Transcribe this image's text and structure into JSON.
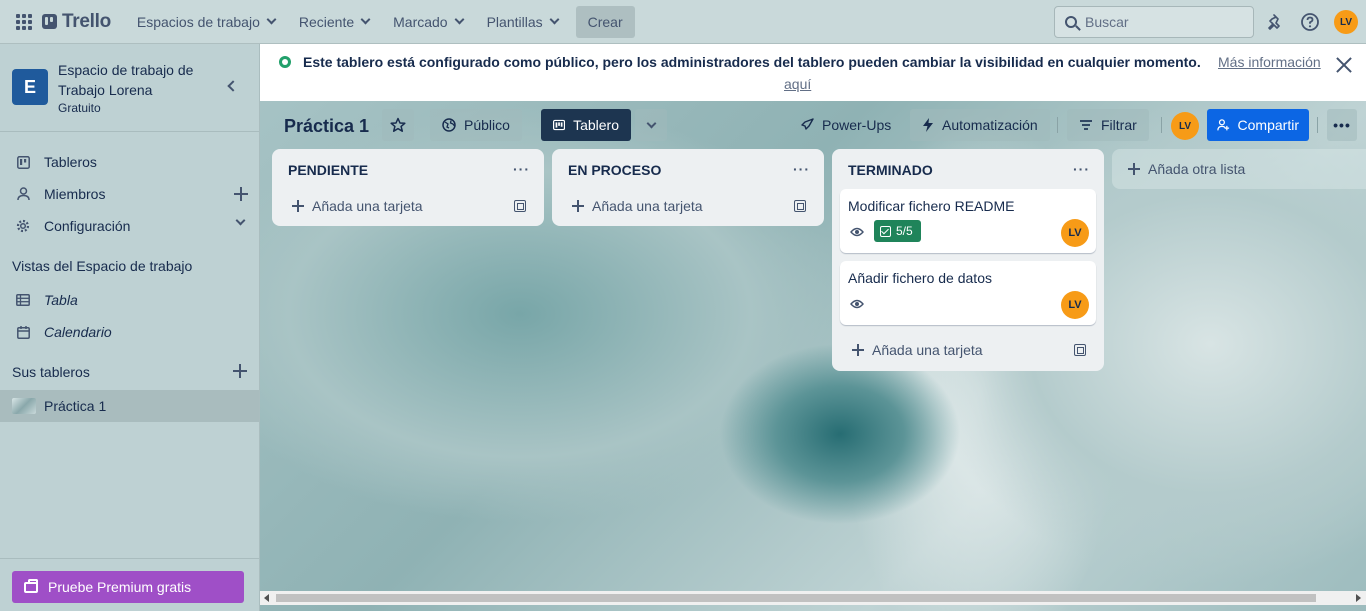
{
  "topnav": {
    "logo": "Trello",
    "menus": [
      "Espacios de trabajo",
      "Reciente",
      "Marcado",
      "Plantillas"
    ],
    "create_label": "Crear",
    "search_placeholder": "Buscar",
    "avatar_initials": "LV"
  },
  "sidebar": {
    "workspace_initial": "E",
    "workspace_name_line1": "Espacio de trabajo de",
    "workspace_name_line2": "Trabajo Lorena",
    "workspace_plan": "Gratuito",
    "items": [
      {
        "label": "Tableros",
        "icon": "board-icon"
      },
      {
        "label": "Miembros",
        "icon": "person-icon"
      },
      {
        "label": "Configuración",
        "icon": "gear-icon"
      }
    ],
    "views_title": "Vistas del Espacio de trabajo",
    "views": [
      {
        "label": "Tabla",
        "icon": "table-icon"
      },
      {
        "label": "Calendario",
        "icon": "calendar-icon"
      }
    ],
    "boards_title": "Sus tableros",
    "boards": [
      {
        "label": "Práctica 1"
      }
    ],
    "premium_label": "Pruebe Premium gratis"
  },
  "banner": {
    "text": "Este tablero está configurado como público, pero los administradores del tablero pueden cambiar la visibilidad en cualquier momento.",
    "link_part1": "Más información",
    "link_part2": "aquí"
  },
  "board": {
    "title": "Práctica 1",
    "visibility": "Público",
    "view": "Tablero",
    "powerups": "Power-Ups",
    "automation": "Automatización",
    "filter": "Filtrar",
    "member_initials": "LV",
    "share": "Compartir",
    "add_list": "Añada otra lista"
  },
  "lists": [
    {
      "title": "PENDIENTE",
      "add_card": "Añada una tarjeta",
      "cards": []
    },
    {
      "title": "EN PROCESO",
      "add_card": "Añada una tarjeta",
      "cards": []
    },
    {
      "title": "TERMINADO",
      "add_card": "Añada una tarjeta",
      "cards": [
        {
          "title": "Modificar fichero README",
          "checklist": "5/5",
          "member": "LV"
        },
        {
          "title": "Añadir fichero de datos",
          "member": "LV"
        }
      ]
    }
  ],
  "colors": {
    "accent": "#1f5a9c",
    "share_button": "#0c66e4",
    "premium": "#9f4fc7",
    "avatar": "#f79b17",
    "checklist_complete": "#1f845a"
  }
}
